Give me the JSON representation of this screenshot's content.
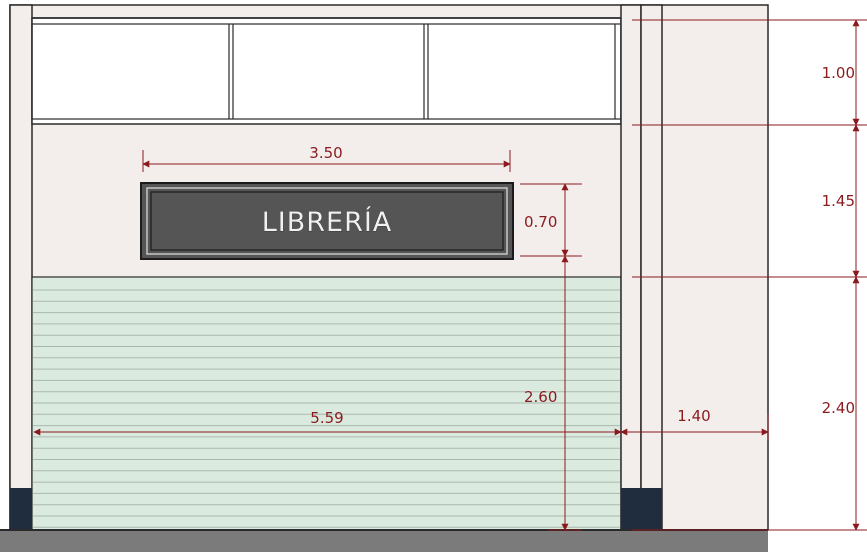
{
  "sign": {
    "text": "LIBRERÍA"
  },
  "dimensions": {
    "sign_width": "3.50",
    "sign_height": "0.70",
    "shutter_height": "2.60",
    "facade_width": "5.59",
    "side_width": "1.40",
    "top_band": "1.00",
    "middle_band": "1.45",
    "lower_band": "2.40"
  },
  "colors": {
    "dimension_line": "#8b1a1f",
    "wall": "#f3eeec",
    "shutter": "#dbeadf",
    "sign_background": "#555555",
    "plinth": "#1f2d3f",
    "ground": "#7b7b7b"
  }
}
